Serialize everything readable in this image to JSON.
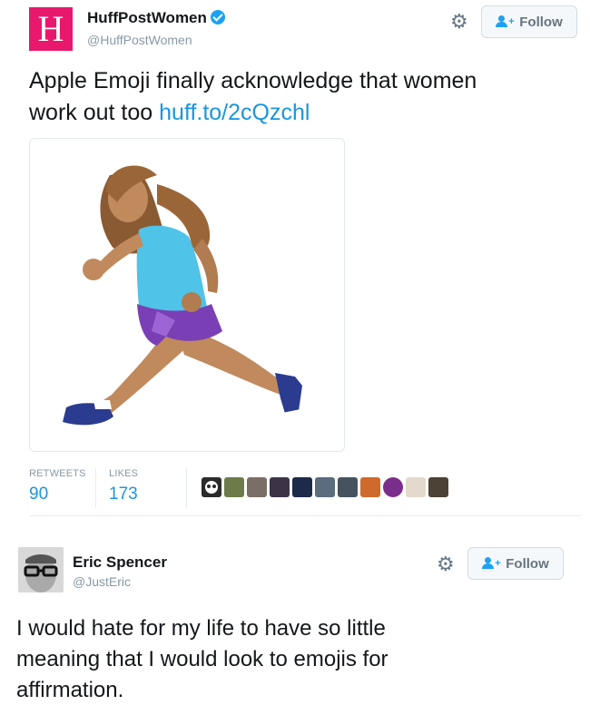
{
  "tweet1": {
    "avatar_letter": "H",
    "display_name": "HuffPostWomen",
    "handle": "@HuffPostWomen",
    "verified_icon": "verified-badge-icon",
    "follow_label": "Follow",
    "text_line1": "Apple Emoji finally acknowledge that women",
    "text_line2_plain": "work out too ",
    "link": "huff.to/2cQzchl",
    "image": "woman-running-emoji",
    "retweets_label": "RETWEETS",
    "retweets_value": "90",
    "likes_label": "LIKES",
    "likes_value": "173",
    "likers_count": 11
  },
  "tweet2": {
    "display_name": "Eric Spencer",
    "handle": "@JustEric",
    "follow_label": "Follow",
    "text_line1": "I would hate for my life to have so little",
    "text_line2": "meaning that I would look to emojis for",
    "text_line3": "affirmation."
  },
  "colors": {
    "brand_pink": "#e8186d",
    "link_blue": "#1b95e0",
    "twitter_blue": "#1da1f2",
    "muted": "#8899a6"
  },
  "icons": [
    "gear-icon",
    "follow-person-icon",
    "verified-badge-icon"
  ]
}
